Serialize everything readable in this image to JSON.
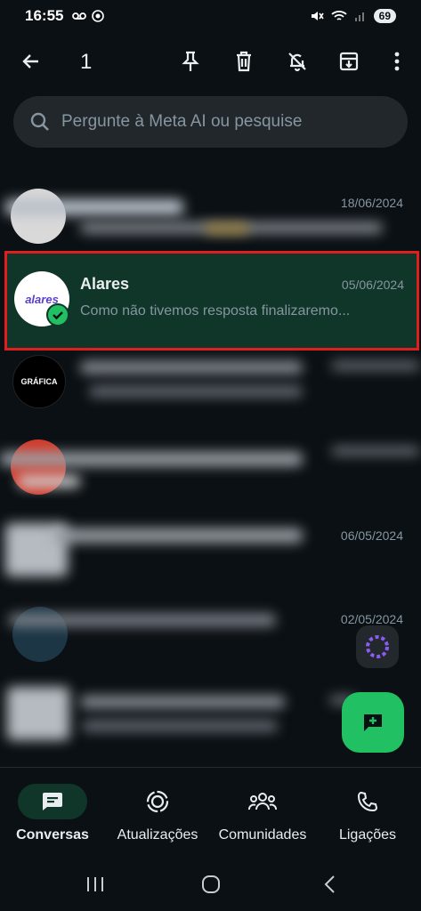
{
  "status_bar": {
    "time": "16:55",
    "battery": "69"
  },
  "action_bar": {
    "selected_count": "1"
  },
  "search": {
    "placeholder": "Pergunte à Meta AI ou pesquise"
  },
  "chats": [
    {
      "name": "",
      "date": "18/06/2024",
      "preview": ""
    },
    {
      "name": "Alares",
      "date": "05/06/2024",
      "preview": "Como não tivemos resposta finalizaremo...",
      "avatar_text": "alares",
      "selected": true
    },
    {
      "name": "",
      "date": "",
      "preview": "",
      "avatar_text": "GRÁFICA"
    },
    {
      "name": "",
      "date": "",
      "preview": ""
    },
    {
      "name": "",
      "date": "06/05/2024",
      "preview": ""
    },
    {
      "name": "",
      "date": "02/05/2024",
      "preview": ""
    },
    {
      "name": "",
      "date": "",
      "preview": ""
    }
  ],
  "nav": [
    {
      "label": "Conversas",
      "icon": "chat-icon",
      "active": true
    },
    {
      "label": "Atualizações",
      "icon": "status-icon"
    },
    {
      "label": "Comunidades",
      "icon": "communities-icon"
    },
    {
      "label": "Ligações",
      "icon": "phone-icon"
    }
  ],
  "colors": {
    "accent": "#21c063",
    "selected_bg": "#103629",
    "highlight_border": "#e01e1e",
    "background": "#0b1014"
  }
}
